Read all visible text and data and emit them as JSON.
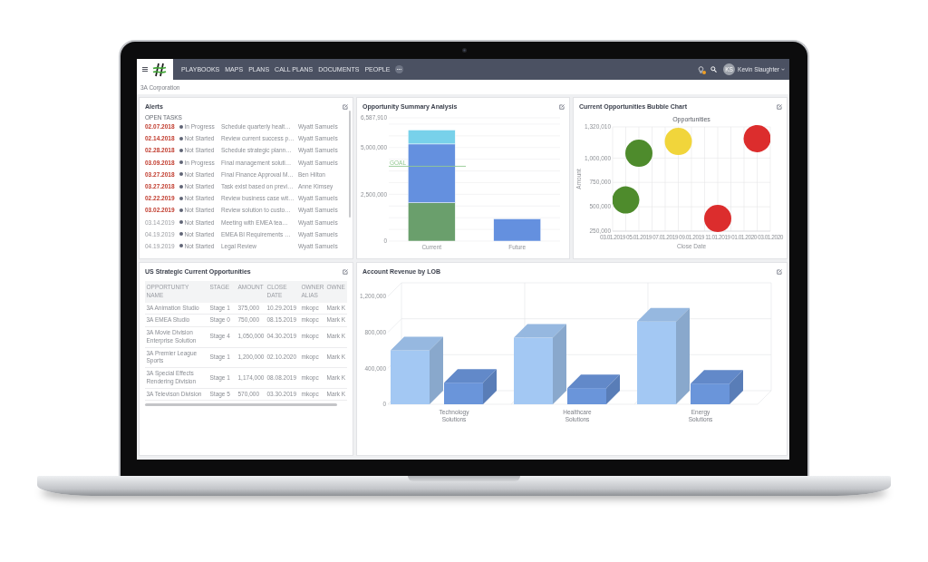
{
  "top_bar": {
    "nav_items": [
      "PLAYBOOKS",
      "MAPS",
      "PLANS",
      "CALL PLANS",
      "DOCUMENTS",
      "PEOPLE"
    ],
    "user": {
      "initials": "KS",
      "name": "Kevin Slaughter"
    }
  },
  "breadcrumb": "3A Corporation",
  "alerts": {
    "title": "Alerts",
    "section": "OPEN TASKS",
    "rows": [
      {
        "date": "02.07.2018",
        "overdue": true,
        "status": "In Progress",
        "task": "Schedule quarterly healt…",
        "owner": "Wyatt Samuels"
      },
      {
        "date": "02.14.2018",
        "overdue": true,
        "status": "Not Started",
        "task": "Review current success p…",
        "owner": "Wyatt Samuels"
      },
      {
        "date": "02.28.2018",
        "overdue": true,
        "status": "Not Started",
        "task": "Schedule strategic plann…",
        "owner": "Wyatt Samuels"
      },
      {
        "date": "03.09.2018",
        "overdue": true,
        "status": "In Progress",
        "task": "Final management soluti…",
        "owner": "Wyatt Samuels"
      },
      {
        "date": "03.27.2018",
        "overdue": true,
        "status": "Not Started",
        "task": "Final Finance Approval M…",
        "owner": "Ben Hilton"
      },
      {
        "date": "03.27.2018",
        "overdue": true,
        "status": "Not Started",
        "task": "Task exist based on previ…",
        "owner": "Anne Kimsey"
      },
      {
        "date": "02.22.2019",
        "overdue": true,
        "status": "Not Started",
        "task": "Review business case wit…",
        "owner": "Wyatt Samuels"
      },
      {
        "date": "03.02.2019",
        "overdue": true,
        "status": "Not Started",
        "task": "Review solution to custo…",
        "owner": "Wyatt Samuels"
      },
      {
        "date": "03.14.2019",
        "overdue": false,
        "status": "Not Started",
        "task": "Meeting with EMEA tea…",
        "owner": "Wyatt Samuels"
      },
      {
        "date": "04.19.2019",
        "overdue": false,
        "status": "Not Started",
        "task": "EMEA BI Requirements …",
        "owner": "Wyatt Samuels"
      },
      {
        "date": "04.19.2019",
        "overdue": false,
        "status": "Not Started",
        "task": "Legal Review",
        "owner": "Wyatt Samuels"
      }
    ]
  },
  "opportunity_summary": {
    "title": "Opportunity Summary Analysis",
    "chart_data": {
      "type": "bar",
      "stacked": true,
      "categories": [
        "Current",
        "Future"
      ],
      "series": [
        {
          "color": "#6a9f6c",
          "values": [
            2050000,
            0
          ]
        },
        {
          "color": "#6490df",
          "values": [
            3140000,
            1190000
          ]
        },
        {
          "color": "#78d1ea",
          "values": [
            750000,
            0
          ]
        }
      ],
      "ylim": [
        0,
        6587910
      ],
      "yticks": [
        0,
        {
          "value": 2500000,
          "label": "2,500,000"
        },
        {
          "value": 5000000,
          "label": "5,000,000"
        },
        {
          "value": 6587910,
          "label": "6,587,910"
        }
      ],
      "ref_lines": [
        {
          "axis": "y",
          "value": 4000000,
          "label": "GOAL"
        }
      ]
    }
  },
  "bubble_chart": {
    "title": "Current Opportunities Bubble Chart",
    "chart_data": {
      "type": "scatter",
      "title": "Opportunities",
      "xlabel": "Close Date",
      "ylabel": "Amount",
      "grid": true,
      "categories": [
        "03.01.2019",
        null,
        "05.01.2019",
        null,
        "07.01.2019",
        null,
        "09.01.2019",
        null,
        "11.01.2019",
        null,
        "01.01.2020",
        null,
        "03.01.2020"
      ],
      "ylim": [
        250000,
        1320010
      ],
      "yticks": [
        {
          "value": 250000,
          "label": "250,000"
        },
        {
          "value": 500000,
          "label": "500,000"
        },
        {
          "value": 750000,
          "label": "750,000"
        },
        {
          "value": 1000000,
          "label": "1,000,000"
        },
        {
          "value": 1320010,
          "label": "1,320,010"
        }
      ],
      "series": [
        {
          "color": "#4e8b2c",
          "values": [
            null,
            570000,
            1050000,
            null,
            null,
            null,
            null,
            null,
            null,
            null,
            null,
            null,
            null
          ]
        },
        {
          "color": "#f1d53b",
          "values": [
            null,
            null,
            null,
            null,
            null,
            1170000,
            null,
            null,
            null,
            null,
            null,
            null,
            null
          ]
        },
        {
          "color": "#dc2d2d",
          "values": [
            null,
            null,
            null,
            null,
            null,
            null,
            null,
            null,
            380000,
            null,
            null,
            1200000,
            null
          ]
        }
      ]
    }
  },
  "strategic_opportunities": {
    "title": "US Strategic Current Opportunities",
    "columns": [
      "OPPORTUNITY NAME",
      "STAGE",
      "AMOUNT",
      "CLOSE DATE",
      "OWNER ALIAS",
      "OWNE"
    ],
    "rows": [
      [
        "3A Animation Studio",
        "Stage 1",
        "375,000",
        "10.29.2019",
        "mkopc",
        "Mark K"
      ],
      [
        "3A EMEA Studio",
        "Stage 0",
        "750,000",
        "08.15.2019",
        "mkopc",
        "Mark K"
      ],
      [
        "3A Movie Division Enterprise Solution",
        "Stage 4",
        "1,050,000",
        "04.30.2019",
        "mkopc",
        "Mark K"
      ],
      [
        "3A Premier League Sports",
        "Stage 1",
        "1,200,000",
        "02.10.2020",
        "mkopc",
        "Mark K"
      ],
      [
        "3A Special Effects Rendering Division",
        "Stage 1",
        "1,174,000",
        "08.08.2019",
        "mkopc",
        "Mark K"
      ],
      [
        "3A Televison Division",
        "Stage 5",
        "570,000",
        "03.30.2019",
        "mkopc",
        "Mark K"
      ]
    ]
  },
  "account_revenue": {
    "title": "Account Revenue by LOB",
    "chart_data": {
      "type": "bar",
      "categories": [
        "Technology Solutions",
        "Healthcare Solutions",
        "Energy Solutions"
      ],
      "series": [
        {
          "color": "#a3c8f3",
          "values": [
            600000,
            740000,
            920000
          ]
        },
        {
          "color": "#6a95da",
          "values": [
            240000,
            180000,
            230000
          ]
        }
      ],
      "ylim": [
        0,
        1200000
      ],
      "yticks": [
        0,
        {
          "value": 400000,
          "label": "400,000"
        },
        {
          "value": 800000,
          "label": "800,000"
        },
        {
          "value": 1200000,
          "label": "1,200,000"
        }
      ]
    }
  }
}
